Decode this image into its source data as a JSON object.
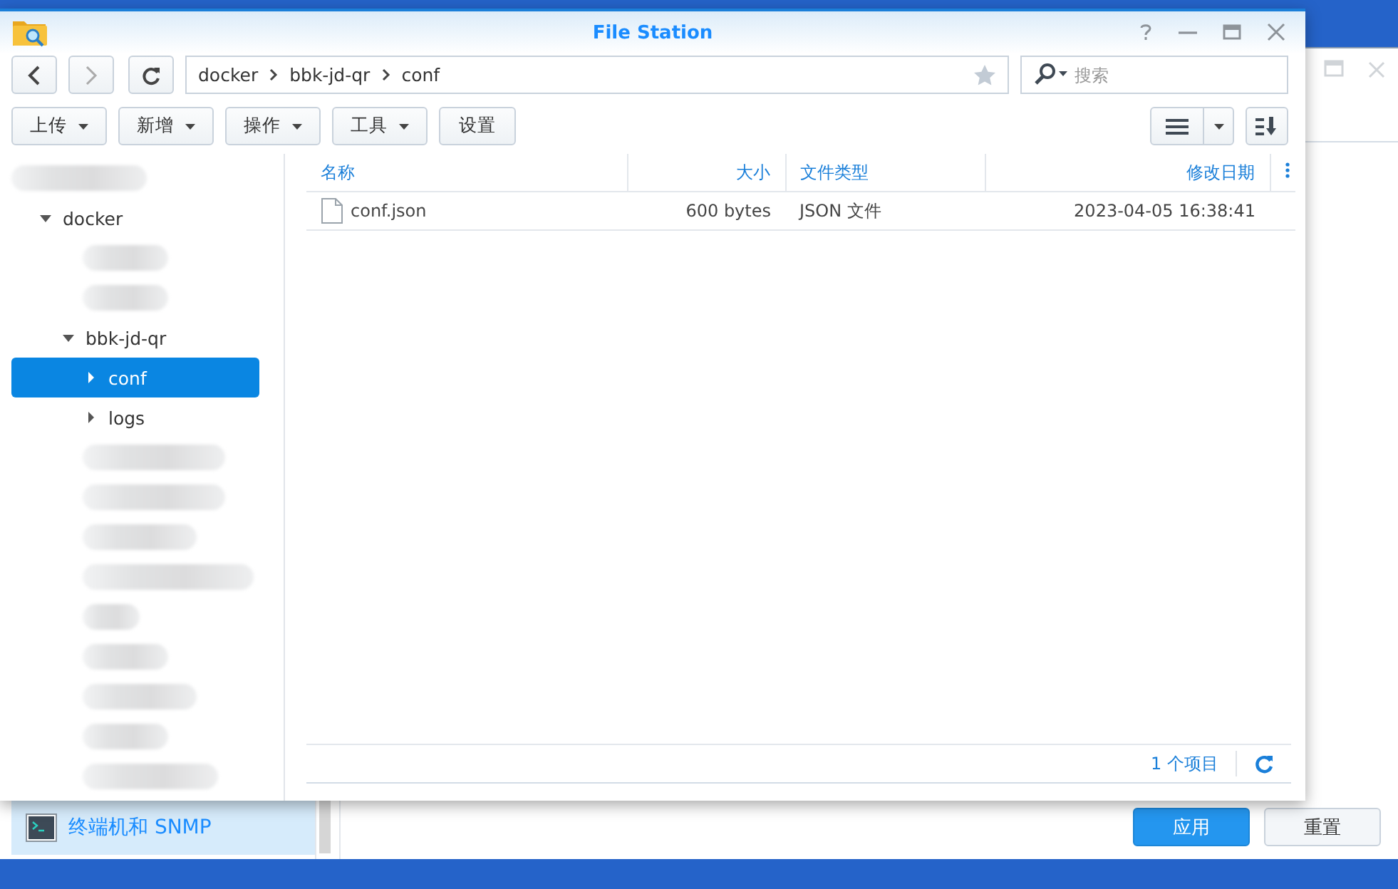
{
  "background_window": {
    "sidebar_items": [
      {
        "label": "终端机和 SNMP",
        "selected": true
      }
    ],
    "buttons": [
      {
        "label": "应用",
        "kind": "primary"
      },
      {
        "label": "重置",
        "kind": "secondary"
      }
    ]
  },
  "window": {
    "title": "File Station"
  },
  "navigation": {
    "breadcrumb": [
      "docker",
      "bbk-jd-qr",
      "conf"
    ],
    "search": {
      "placeholder": "搜索"
    }
  },
  "actions": [
    {
      "label": "上传",
      "dropdown": true
    },
    {
      "label": "新增",
      "dropdown": true
    },
    {
      "label": "操作",
      "dropdown": true
    },
    {
      "label": "工具",
      "dropdown": true
    },
    {
      "label": "设置",
      "dropdown": false
    }
  ],
  "tree": [
    {
      "kind": "redacted",
      "children": [
        {
          "kind": "folder",
          "label": "docker",
          "expanded": true,
          "selected": false,
          "children": [
            {
              "kind": "redacted"
            },
            {
              "kind": "redacted"
            },
            {
              "kind": "folder",
              "label": "bbk-jd-qr",
              "expanded": true,
              "selected": false,
              "children": [
                {
                  "kind": "folder",
                  "label": "conf",
                  "expanded": false,
                  "selected": true
                },
                {
                  "kind": "folder",
                  "label": "logs",
                  "expanded": false,
                  "selected": false
                }
              ]
            },
            {
              "kind": "redacted"
            },
            {
              "kind": "redacted"
            },
            {
              "kind": "redacted"
            },
            {
              "kind": "redacted"
            },
            {
              "kind": "redacted"
            },
            {
              "kind": "redacted"
            },
            {
              "kind": "redacted"
            },
            {
              "kind": "redacted"
            },
            {
              "kind": "redacted"
            }
          ]
        }
      ]
    }
  ],
  "table": {
    "columns": [
      {
        "label": "名称"
      },
      {
        "label": "大小"
      },
      {
        "label": "文件类型"
      },
      {
        "label": "修改日期"
      }
    ],
    "rows": [
      {
        "cells": [
          "conf.json",
          "600 bytes",
          "JSON 文件",
          "2023-04-05 16:38:41"
        ]
      }
    ]
  },
  "status_bar": {
    "count": "1 个项目"
  }
}
